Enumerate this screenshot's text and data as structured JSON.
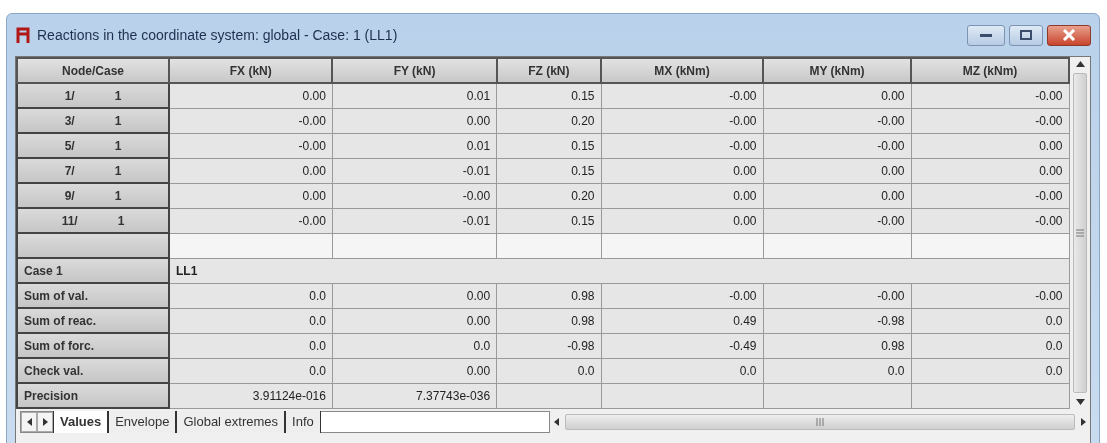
{
  "window": {
    "title": "Reactions in the coordinate system: global - Case: 1 (LL1)"
  },
  "table": {
    "columns": [
      "Node/Case",
      "FX (kN)",
      "FY (kN)",
      "FZ (kN)",
      "MX (kNm)",
      "MY (kNm)",
      "MZ (kNm)"
    ],
    "rows": [
      {
        "node": "1/",
        "case": "1",
        "values": [
          "0.00",
          "0.01",
          "0.15",
          "-0.00",
          "0.00",
          "-0.00"
        ]
      },
      {
        "node": "3/",
        "case": "1",
        "values": [
          "-0.00",
          "0.00",
          "0.20",
          "-0.00",
          "-0.00",
          "-0.00"
        ]
      },
      {
        "node": "5/",
        "case": "1",
        "values": [
          "-0.00",
          "0.01",
          "0.15",
          "-0.00",
          "-0.00",
          "0.00"
        ]
      },
      {
        "node": "7/",
        "case": "1",
        "values": [
          "0.00",
          "-0.01",
          "0.15",
          "0.00",
          "0.00",
          "0.00"
        ]
      },
      {
        "node": "9/",
        "case": "1",
        "values": [
          "0.00",
          "-0.00",
          "0.20",
          "0.00",
          "0.00",
          "-0.00"
        ]
      },
      {
        "node": "11/",
        "case": "1",
        "values": [
          "-0.00",
          "-0.01",
          "0.15",
          "0.00",
          "-0.00",
          "-0.00"
        ]
      }
    ],
    "case_row": {
      "label": "Case 1",
      "value": "LL1"
    },
    "summary": [
      {
        "label": "Sum of val.",
        "values": [
          "0.0",
          "0.00",
          "0.98",
          "-0.00",
          "-0.00",
          "-0.00"
        ]
      },
      {
        "label": "Sum of reac.",
        "values": [
          "0.0",
          "0.00",
          "0.98",
          "0.49",
          "-0.98",
          "0.0"
        ]
      },
      {
        "label": "Sum of forc.",
        "values": [
          "0.0",
          "0.0",
          "-0.98",
          "-0.49",
          "0.98",
          "0.0"
        ]
      },
      {
        "label": "Check val.",
        "values": [
          "0.0",
          "0.00",
          "0.0",
          "0.0",
          "0.0",
          "0.0"
        ]
      },
      {
        "label": "Precision",
        "values": [
          "3.91124e-016",
          "7.37743e-036"
        ]
      }
    ]
  },
  "tabs": [
    {
      "label": "Values",
      "selected": true
    },
    {
      "label": "Envelope",
      "selected": false
    },
    {
      "label": "Global extremes",
      "selected": false
    },
    {
      "label": "Info",
      "selected": false
    }
  ]
}
